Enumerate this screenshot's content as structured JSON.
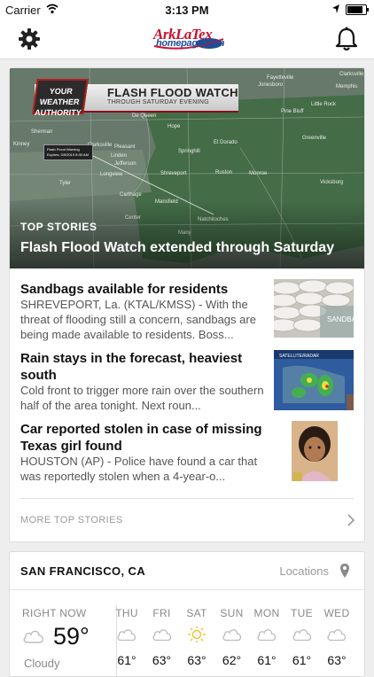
{
  "status_bar": {
    "carrier": "Carrier",
    "time": "3:13 PM",
    "battery_level": 0.85
  },
  "nav": {
    "logo_line1": "ArkLaTex",
    "logo_line2": "homepage.com"
  },
  "hero": {
    "label": "TOP STORIES",
    "headline": "Flash Flood Watch extended through Saturday",
    "graphic_title": "FLASH FLOOD WATCH",
    "graphic_subtitle": "THROUGH SATURDAY EVENING",
    "graphic_badge": "YOUR WEATHER AUTHORITY",
    "warning_box": "Flash Flood Warning Expires: 3/9/2019 8:30 AM",
    "map_places": [
      "Fayetteville",
      "Jonesboro",
      "Clarksville",
      "Memphis",
      "Little Rock",
      "Pine Bluff",
      "De Queen",
      "Hope",
      "Sherman",
      "Kinney",
      "Clarksville",
      "Pleasant",
      "Linden",
      "Jefferson",
      "Springhill",
      "El Dorado",
      "Greenville",
      "Tyler",
      "Longview",
      "Shreveport",
      "Ruston",
      "Monroe",
      "Vicksburg",
      "Carthage",
      "Mansfield",
      "Natchitoches",
      "Center",
      "Many"
    ]
  },
  "stories": [
    {
      "title": "Sandbags available for residents",
      "desc": "SHREVEPORT, La. (KTAL/KMSS) - With the threat of flooding still a concern, sandbags are being made available to residents. Boss...",
      "thumb_text": "SANDBAG AVAILAB"
    },
    {
      "title": "Rain stays in the forecast, heaviest south",
      "desc": "Cold front to trigger more rain over the southern half of the area tonight. Next roun...",
      "thumb_text": "SATELLITE/RADAR"
    },
    {
      "title": "Car reported stolen in case of missing Texas girl found",
      "desc": "HOUSTON (AP) - Police have found a car that was reportedly stolen when a 4-year-o...",
      "thumb_text": ""
    }
  ],
  "more_label": "MORE TOP STORIES",
  "weather": {
    "city": "SAN FRANCISCO, CA",
    "locations_label": "Locations",
    "now_label": "RIGHT NOW",
    "now_temp": "59°",
    "now_condition": "Cloudy",
    "days": [
      {
        "name": "THU",
        "temp": "61°",
        "icon": "cloud-icon"
      },
      {
        "name": "FRI",
        "temp": "63°",
        "icon": "cloud-icon"
      },
      {
        "name": "SAT",
        "temp": "63°",
        "icon": "sun-icon"
      },
      {
        "name": "SUN",
        "temp": "62°",
        "icon": "cloud-icon"
      },
      {
        "name": "MON",
        "temp": "61°",
        "icon": "cloud-icon"
      },
      {
        "name": "TUE",
        "temp": "61°",
        "icon": "cloud-icon"
      },
      {
        "name": "WED",
        "temp": "63°",
        "icon": "cloud-icon"
      }
    ],
    "colors": {
      "sun": "#f2c230",
      "cloud_stroke": "#bdbdbd"
    }
  }
}
